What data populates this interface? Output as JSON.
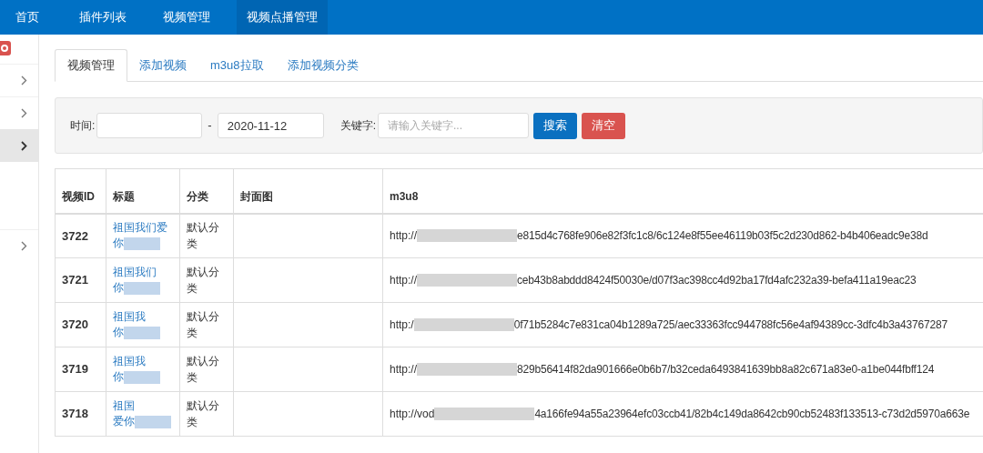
{
  "top_nav": [
    {
      "label": "首页",
      "selected": false
    },
    {
      "label": "插件列表",
      "selected": false
    },
    {
      "label": "视频管理",
      "selected": false
    },
    {
      "label": "视频点播管理",
      "selected": true
    }
  ],
  "sidebar": {
    "items": [
      {
        "selected": false
      },
      {
        "selected": false
      },
      {
        "selected": true
      },
      {
        "selected": false
      }
    ]
  },
  "tabs": [
    {
      "label": "视频管理",
      "selected": true
    },
    {
      "label": "添加视频",
      "selected": false
    },
    {
      "label": "m3u8拉取",
      "selected": false
    },
    {
      "label": "添加视频分类",
      "selected": false
    }
  ],
  "filter": {
    "time_label": "时间:",
    "separator": "-",
    "end": {
      "value": "2020-11-12"
    },
    "keyword_label": "关键字:",
    "keyword": {
      "placeholder": "请输入关键字..."
    },
    "search_button": "搜索",
    "clear_button": "清空"
  },
  "table": {
    "columns": [
      "视频ID",
      "标题",
      "分类",
      "封面图",
      "m3u8"
    ],
    "rows": [
      {
        "id": "3722",
        "title": [
          "祖国我们爱",
          "你"
        ],
        "category": "默认分类",
        "url_start": "http://",
        "url_end": "e815d4c768fe906e82f3fc1c8/6c124e8f55ee46119b03f5c2d230d862-b4b406eadc9e38d"
      },
      {
        "id": "3721",
        "title": [
          "祖国我们",
          "你"
        ],
        "category": "默认分类",
        "url_start": "http://",
        "url_end": "ceb43b8abddd8424f50030e/d07f3ac398cc4d92ba17fd4afc232a39-befa411a19eac23"
      },
      {
        "id": "3720",
        "title": [
          "祖国我",
          "你"
        ],
        "category": "默认分类",
        "url_start": "http:/",
        "url_end": "0f71b5284c7e831ca04b1289a725/aec33363fcc944788fc56e4af94389cc-3dfc4b3a43767287"
      },
      {
        "id": "3719",
        "title": [
          "祖国我",
          "你"
        ],
        "category": "默认分类",
        "url_start": "http://",
        "url_end": "829b56414f82da901666e0b6b7/b32ceda6493841639bb8a82c671a83e0-a1be044fbff124"
      },
      {
        "id": "3718",
        "title": [
          "祖国",
          "爱你"
        ],
        "category": "默认分类",
        "url_start": "http://vod",
        "url_end": "4a166fe94a55a23964efc03ccb41/82b4c149da8642cb90cb52483f133513-c73d2d5970a663e"
      }
    ]
  }
}
